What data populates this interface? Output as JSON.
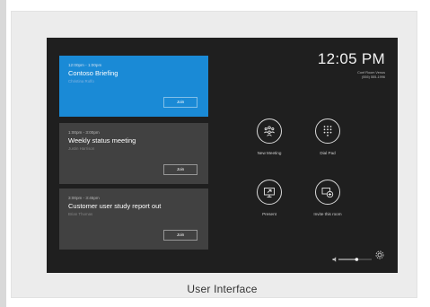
{
  "caption": "User Interface",
  "clock": {
    "time": "12:05 PM",
    "room_name": "Conf Room Venus",
    "room_number": "(555) 555-1996"
  },
  "meetings": [
    {
      "time": "12:00pm - 1:00pm",
      "title": "Contoso Briefing",
      "organizer": "Christina Rolfo",
      "join_label": "Join",
      "highlighted": true
    },
    {
      "time": "1:00pm - 3:00pm",
      "title": "Weekly status meeting",
      "organizer": "Justin Harrison",
      "join_label": "Join",
      "highlighted": false
    },
    {
      "time": "3:00pm - 3:45pm",
      "title": "Customer user study report out",
      "organizer": "Brian Thomas",
      "join_label": "Join",
      "highlighted": false
    }
  ],
  "actions": [
    {
      "label": "New Meeting",
      "icon": "people-icon"
    },
    {
      "label": "Dial Pad",
      "icon": "dial-pad-icon"
    },
    {
      "label": "Present",
      "icon": "present-icon"
    },
    {
      "label": "Invite this room",
      "icon": "invite-room-icon"
    }
  ],
  "colors": {
    "accent": "#1a8ad6",
    "card": "#414141",
    "screen": "#1f1f1f"
  },
  "volume_level": 0.55,
  "controls": {
    "volume_icon": "speaker-icon",
    "settings_icon": "gear-icon"
  }
}
